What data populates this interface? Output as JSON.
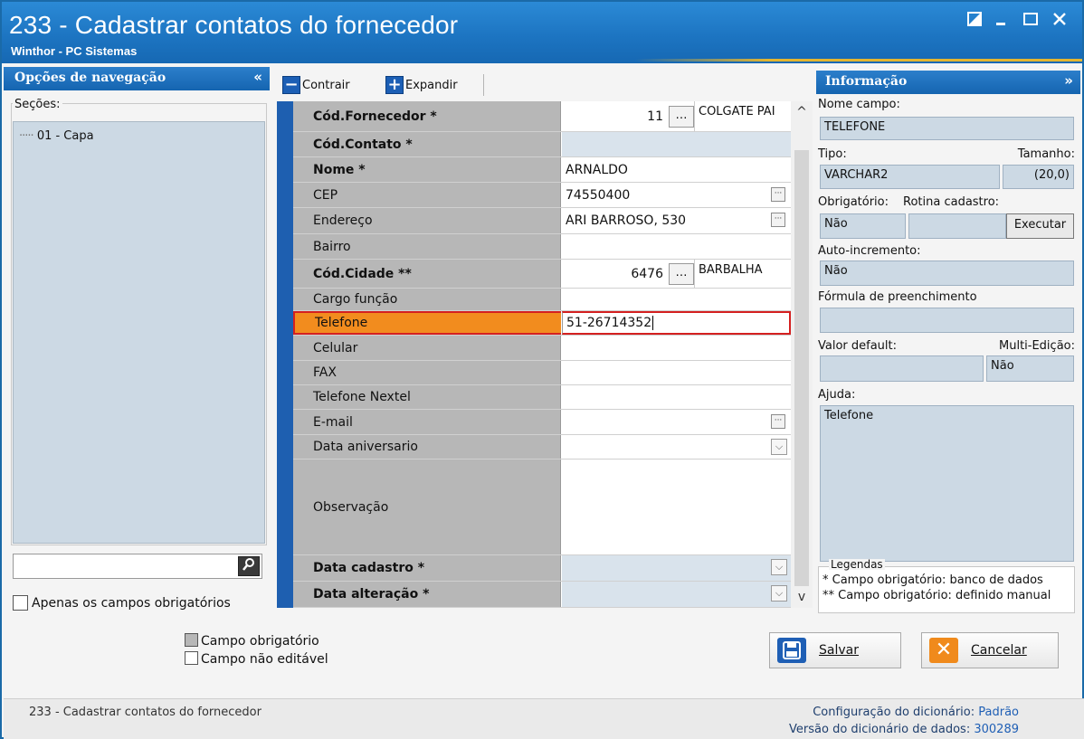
{
  "window": {
    "title": "233 - Cadastrar contatos do fornecedor",
    "subtitle": "Winthor - PC Sistemas",
    "controls": [
      "restore-icon",
      "minimize-icon",
      "maximize-icon",
      "close-icon"
    ]
  },
  "left_panel": {
    "header": "Opções de navegação",
    "collapse_glyph": "«",
    "sections_label": "Seções:",
    "tree_items": [
      "01 - Capa"
    ],
    "search_placeholder": "",
    "only_required_label": "Apenas os campos obrigatórios"
  },
  "toolbar": {
    "collapse_label": "Contrair",
    "expand_label": "Expandir"
  },
  "form_rows": {
    "cod_fornecedor": {
      "label": "Cód.Fornecedor *",
      "value": "11",
      "name": "COLGATE PAI"
    },
    "cod_contato": {
      "label": "Cód.Contato *",
      "value": ""
    },
    "nome": {
      "label": "Nome *",
      "value": "ARNALDO"
    },
    "cep": {
      "label": "CEP",
      "value": "74550400"
    },
    "endereco": {
      "label": "Endereço",
      "value": "ARI BARROSO, 530"
    },
    "bairro": {
      "label": "Bairro",
      "value": ""
    },
    "cod_cidade": {
      "label": "Cód.Cidade **",
      "value": "6476",
      "name": "BARBALHA"
    },
    "cargo_funcao": {
      "label": "Cargo função",
      "value": ""
    },
    "telefone": {
      "label": "Telefone",
      "value": "51-26714352"
    },
    "celular": {
      "label": "Celular",
      "value": ""
    },
    "fax": {
      "label": "FAX",
      "value": ""
    },
    "telefone_nextel": {
      "label": "Telefone Nextel",
      "value": ""
    },
    "email": {
      "label": "E-mail",
      "value": ""
    },
    "data_aniversario": {
      "label": "Data aniversario",
      "value": ""
    },
    "observacao": {
      "label": "Observação",
      "value": ""
    },
    "data_cadastro": {
      "label": "Data cadastro *",
      "value": ""
    },
    "data_alteracao": {
      "label": "Data alteração *",
      "value": ""
    }
  },
  "info_panel": {
    "header": "Informação",
    "expand_glyph": "»",
    "field_name_label": "Nome campo:",
    "field_name_value": "TELEFONE",
    "type_label": "Tipo:",
    "type_value": "VARCHAR2",
    "size_label": "Tamanho:",
    "size_value": "(20,0)",
    "required_label": "Obrigatório:",
    "required_value": "Não",
    "routine_label": "Rotina cadastro:",
    "routine_value": "",
    "execute_label": "Executar",
    "autoinc_label": "Auto-incremento:",
    "autoinc_value": "Não",
    "formula_label": "Fórmula de preenchimento",
    "formula_value": "",
    "default_label": "Valor default:",
    "default_value": "",
    "multi_label": "Multi-Edição:",
    "multi_value": "Não",
    "help_label": "Ajuda:",
    "help_value": "Telefone",
    "legend_title": "Legendas",
    "legend_1": "* Campo obrigatório: banco de dados",
    "legend_2": "** Campo obrigatório: definido manual"
  },
  "bottom": {
    "legend_required": "Campo obrigatório",
    "legend_readonly": "Campo não editável",
    "save_label": "Salvar",
    "cancel_label": "Cancelar"
  },
  "status": {
    "left": "233 - Cadastrar contatos do fornecedor",
    "dict_config_label": "Configuração do dicionário:",
    "dict_config_value": "Padrão",
    "dict_version_label": "Versão do dicionário de dados:",
    "dict_version_value": "300289"
  },
  "colors": {
    "title_blue": "#1d75c2",
    "selected_orange": "#f28c1e",
    "selected_border": "#d42020",
    "readonly_blue": "#ccd9e4"
  }
}
